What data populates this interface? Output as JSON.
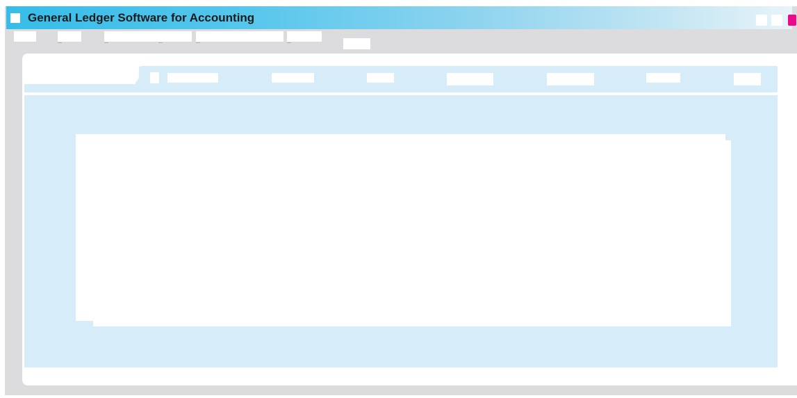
{
  "window": {
    "title": "General Ledger Software for Accounting",
    "icon": "app-icon",
    "controls": [
      "minimize-icon",
      "maximize-icon",
      "close-icon"
    ]
  },
  "colors": {
    "title_gradient_start": "#35bde9",
    "title_gradient_end": "#e8f4f9",
    "close_button": "#ec0a8c",
    "panel_background": "#d6ecf8",
    "window_frame": "#dcdcde"
  },
  "menu": {
    "item_count": 7
  },
  "tabs": {
    "tab_count": 7
  }
}
